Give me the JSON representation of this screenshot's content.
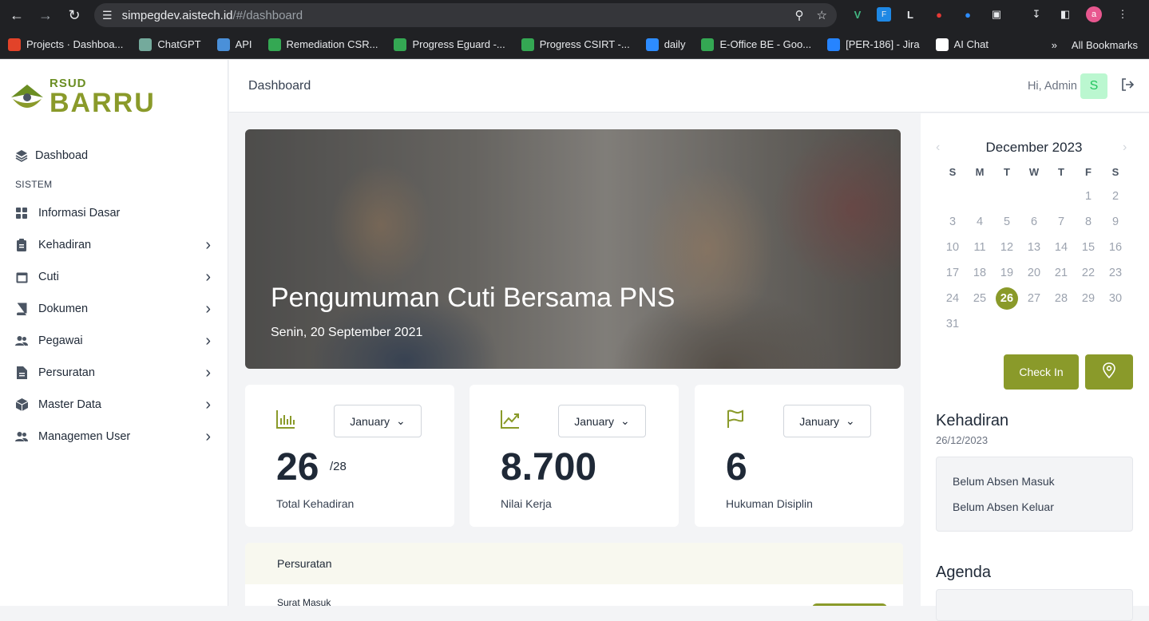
{
  "browser": {
    "host": "simpegdev.aistech.id",
    "path": "/#/dashboard",
    "profile_initial": "a",
    "bookmarks": [
      {
        "label": "Projects · Dashboa...",
        "color": "#e24329"
      },
      {
        "label": "ChatGPT",
        "color": "#74aa9c"
      },
      {
        "label": "API",
        "color": "#4a90d9"
      },
      {
        "label": "Remediation CSR...",
        "color": "#34a853"
      },
      {
        "label": "Progress Eguard -...",
        "color": "#34a853"
      },
      {
        "label": "Progress CSIRT -...",
        "color": "#34a853"
      },
      {
        "label": "daily",
        "color": "#2d8cff"
      },
      {
        "label": "E-Office BE - Goo...",
        "color": "#34a853"
      },
      {
        "label": "[PER-186] - Jira",
        "color": "#2684ff"
      },
      {
        "label": "AI Chat",
        "color": "#ffffff"
      }
    ],
    "all_bookmarks": "All Bookmarks"
  },
  "logo": {
    "small": "RSUD",
    "big": "BARRU"
  },
  "sidebar": {
    "dashboard": "Dashboad",
    "section": "SISTEM",
    "items": [
      {
        "label": "Informasi Dasar",
        "icon": "grid-icon",
        "chevron": false
      },
      {
        "label": "Kehadiran",
        "icon": "clipboard-icon",
        "chevron": true
      },
      {
        "label": "Cuti",
        "icon": "calendar-icon",
        "chevron": true
      },
      {
        "label": "Dokumen",
        "icon": "book-icon",
        "chevron": true
      },
      {
        "label": "Pegawai",
        "icon": "users-icon",
        "chevron": true
      },
      {
        "label": "Persuratan",
        "icon": "file-icon",
        "chevron": true
      },
      {
        "label": "Master Data",
        "icon": "box-icon",
        "chevron": true
      },
      {
        "label": "Managemen User",
        "icon": "users-icon",
        "chevron": true
      }
    ]
  },
  "header": {
    "title": "Dashboard",
    "greeting": "Hi, Admin",
    "avatar": "S"
  },
  "hero": {
    "title": "Pengumuman Cuti Bersama PNS",
    "date": "Senin, 20 September 2021"
  },
  "stats": [
    {
      "month": "January",
      "value": "26",
      "sub": "/28",
      "label": "Total Kehadiran",
      "icon": "bar-chart-icon"
    },
    {
      "month": "January",
      "value": "8.700",
      "sub": "",
      "label": "Nilai Kerja",
      "icon": "trend-up-icon"
    },
    {
      "month": "January",
      "value": "6",
      "sub": "",
      "label": "Hukuman Disiplin",
      "icon": "flag-icon"
    }
  ],
  "persuratan": {
    "title": "Persuratan",
    "row": "Surat Masuk"
  },
  "calendar": {
    "title": "December 2023",
    "dow": [
      "S",
      "M",
      "T",
      "W",
      "T",
      "F",
      "S"
    ],
    "lead_blanks": 5,
    "days": 31,
    "today": 26
  },
  "actions": {
    "checkin": "Check In"
  },
  "kehadiran": {
    "title": "Kehadiran",
    "date": "26/12/2023",
    "lines": [
      "Belum Absen Masuk",
      "Belum Absen Keluar"
    ]
  },
  "agenda": {
    "title": "Agenda"
  },
  "colors": {
    "accent": "#8a9a2a"
  }
}
